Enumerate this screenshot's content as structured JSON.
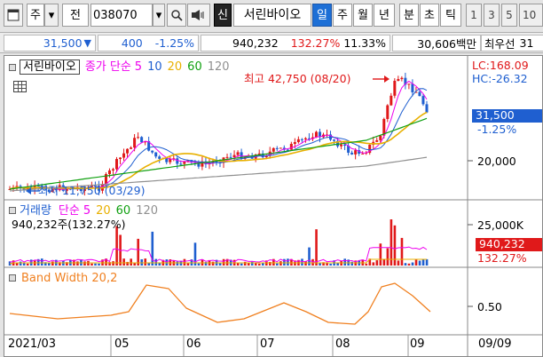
{
  "toolbar": {
    "market": "주",
    "code_kind": "전",
    "code": "038070",
    "new_label": "신",
    "stock_name": "서린바이오",
    "period_tabs": [
      "일",
      "주",
      "월",
      "년",
      "분",
      "초",
      "틱"
    ],
    "active_period": "일",
    "interval_tabs": [
      "1",
      "3",
      "5",
      "10"
    ]
  },
  "quote": {
    "price": "31,500",
    "change": "400",
    "change_pct": "-1.25%",
    "volume": "940,232",
    "volume_ratio": "132.27%",
    "turnover": "11.33%",
    "amount": "30,606백만",
    "label": "최우선",
    "extra": "31"
  },
  "price_panel": {
    "name": "서린바이오",
    "ma_label": "종가 단순",
    "ma_periods": [
      "5",
      "10",
      "20",
      "60",
      "120"
    ],
    "high_text": "최고 42,750 (08/20)",
    "low_text": "최저 11,750 (03/29)",
    "lc": "LC:168.09",
    "hc": "HC:-26.32",
    "price_box": "31,500",
    "change_pct": "-1.25%",
    "axis_label": "20,000"
  },
  "volume_panel": {
    "name": "거래량",
    "ma_label": "단순",
    "ma_periods": [
      "5",
      "20",
      "60",
      "120"
    ],
    "info": "940,232주(132.27%)",
    "axis_label": "25,000K",
    "box_value": "940,232",
    "box_pct": "132.27%"
  },
  "bw_panel": {
    "name": "Band Width 20,2",
    "axis_label": "0.50"
  },
  "xaxis": {
    "labels": [
      "2021/03",
      "05",
      "06",
      "07",
      "08",
      "09"
    ],
    "right": "09/09"
  },
  "colors": {
    "up": "#e0191a",
    "down": "#1f5fd0",
    "ma5": "#e0e",
    "ma10": "#1f5fd0",
    "ma20": "#e8b000",
    "ma60": "#10a010",
    "ma120": "#909090",
    "bw": "#f08020",
    "active_tab": "#1d6fd6"
  },
  "icons": [
    "window-icon",
    "dropdown-arrow-icon",
    "search-icon",
    "speaker-icon",
    "grid-icon"
  ]
}
